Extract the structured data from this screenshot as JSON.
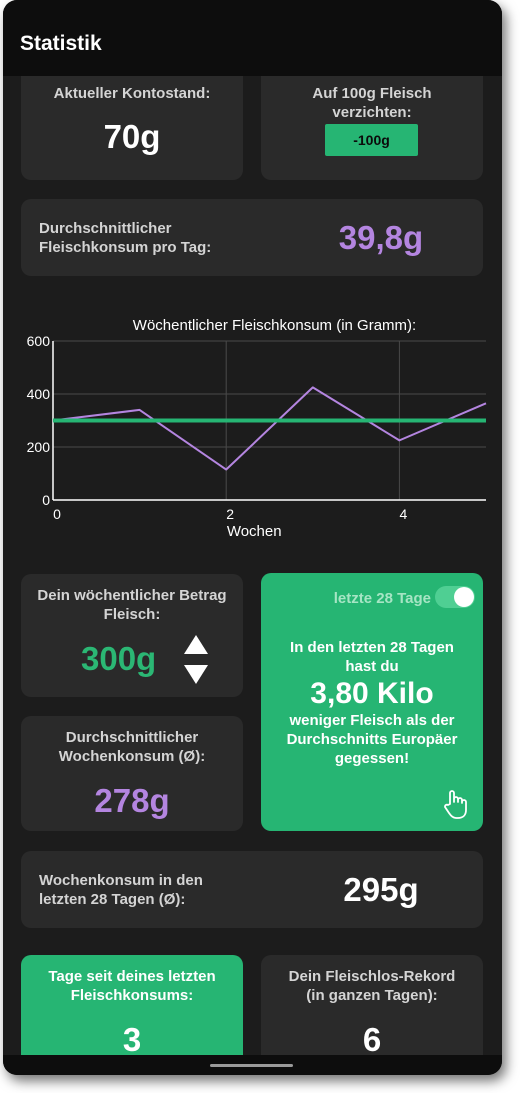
{
  "appbar": {
    "title": "Statistik"
  },
  "balance": {
    "label": "Aktueller Kontostand:",
    "value": "70g"
  },
  "renounce": {
    "label": "Auf 100g Fleisch verzichten:",
    "button": "-100g"
  },
  "daily_avg": {
    "label": "Durchschnittlicher Fleischkonsum pro Tag:",
    "value": "39,8g"
  },
  "chart": {
    "title": "Wöchentlicher Fleischkonsum (in Gramm):",
    "xlabel": "Wochen"
  },
  "chart_data": {
    "type": "line",
    "title": "Wöchentlicher Fleischkonsum (in Gramm):",
    "xlabel": "Wochen",
    "ylabel": "",
    "xlim": [
      0,
      5
    ],
    "ylim": [
      0,
      600
    ],
    "xticks": [
      0,
      2,
      4
    ],
    "yticks": [
      0,
      200,
      400,
      600
    ],
    "grid": true,
    "series": [
      {
        "x": [
          0,
          1,
          2,
          3,
          4,
          5
        ],
        "values": [
          300,
          340,
          115,
          425,
          225,
          365
        ],
        "color": "#b485e0"
      },
      {
        "x": [
          0,
          5
        ],
        "values": [
          300,
          300
        ],
        "color": "#26b573"
      }
    ]
  },
  "weekly_amount": {
    "label": "Dein wöchentlicher Betrag Fleisch:",
    "value": "300g"
  },
  "weekly_avg": {
    "label": "Durchschnittlicher Wochenkonsum (Ø):",
    "value": "278g"
  },
  "comparison": {
    "toggle_label": "letzte 28 Tage",
    "line1": "In den letzten 28 Tagen hast du",
    "value": "3,80 Kilo",
    "line2": "weniger Fleisch als der Durchschnitts Europäer gegessen!"
  },
  "weekly_28": {
    "label": "Wochenkonsum in den letzten 28 Tagen (Ø):",
    "value": "295g"
  },
  "days_since": {
    "label": "Tage seit deines letzten Fleischkonsums:",
    "value": "3"
  },
  "record": {
    "label": "Dein Fleischlos-Rekord (in ganzen Tagen):",
    "value": "6"
  },
  "colors": {
    "accent": "#26b573",
    "purple": "#b485e0",
    "card": "#2a2a2a",
    "background": "#1c1c1c"
  }
}
